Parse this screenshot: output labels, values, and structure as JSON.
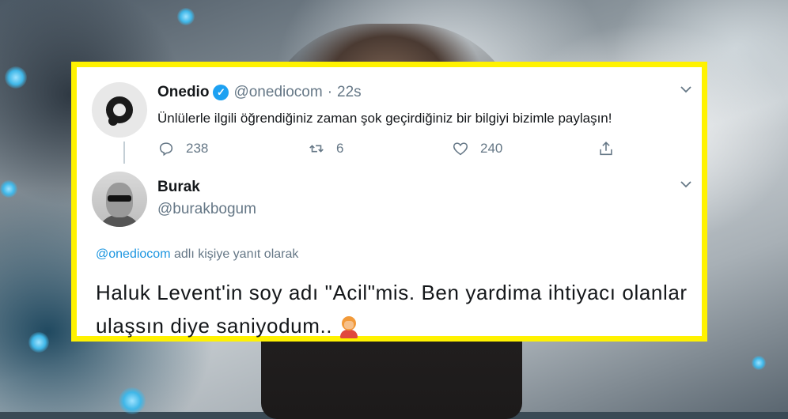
{
  "tweet": {
    "author_name": "Onedio",
    "author_handle": "@onediocom",
    "separator": "·",
    "time": "22s",
    "text": "Ünlülerle ilgili öğrendiğiniz zaman şok geçirdiğiniz bir bilgiyi bizimle paylaşın!",
    "reply_count": "238",
    "retweet_count": "6",
    "like_count": "240"
  },
  "reply": {
    "author_name": "Burak",
    "author_handle": "@burakbogum",
    "replying_link": "@onediocom",
    "replying_suffix": "adlı kişiye yanıt olarak",
    "text": "Haluk Levent'in soy adı \"Acil\"mis. Ben yardima ihtiyacı olanlar ulaşsın diye saniyodum.."
  },
  "colors": {
    "highlight_border": "#fff200",
    "verified_blue": "#1da1f2",
    "link_blue": "#1b95e0",
    "muted_gray": "#657786"
  },
  "icons": [
    "verified-badge-icon",
    "chevron-down-icon",
    "reply-icon",
    "retweet-icon",
    "like-icon",
    "share-icon",
    "facepalm-emoji-icon"
  ]
}
